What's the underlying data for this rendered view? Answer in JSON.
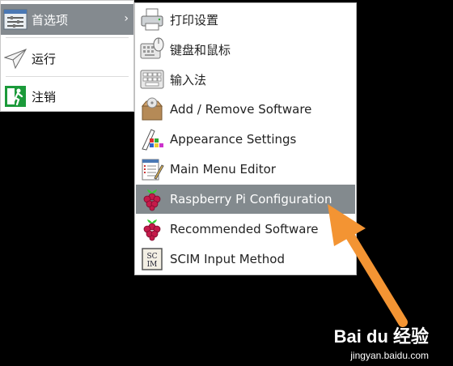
{
  "main_menu": {
    "items": [
      {
        "label": "首选项",
        "icon": "preferences-icon",
        "active": true
      },
      {
        "label": "运行",
        "icon": "paper-plane-icon"
      },
      {
        "label": "注销",
        "icon": "exit-running-man-icon"
      }
    ]
  },
  "sub_menu": {
    "items": [
      {
        "label": "打印设置",
        "icon": "printer-icon"
      },
      {
        "label": "键盘和鼠标",
        "icon": "keyboard-mouse-icon"
      },
      {
        "label": "输入法",
        "icon": "keyboard-icon"
      },
      {
        "label": "Add / Remove Software",
        "icon": "package-box-icon"
      },
      {
        "label": "Appearance Settings",
        "icon": "appearance-palette-icon"
      },
      {
        "label": "Main Menu Editor",
        "icon": "menu-editor-icon"
      },
      {
        "label": "Raspberry Pi Configuration",
        "icon": "raspberry-pi-icon",
        "active": true
      },
      {
        "label": "Recommended Software",
        "icon": "raspberry-pi-icon"
      },
      {
        "label": "SCIM Input Method",
        "icon": "scim-icon"
      }
    ]
  },
  "watermark": {
    "logo": "Bai du 经验",
    "url": "jingyan.baidu.com"
  },
  "colors": {
    "highlight": "#838a8e",
    "arrow": "#f39433",
    "background": "#000000"
  }
}
